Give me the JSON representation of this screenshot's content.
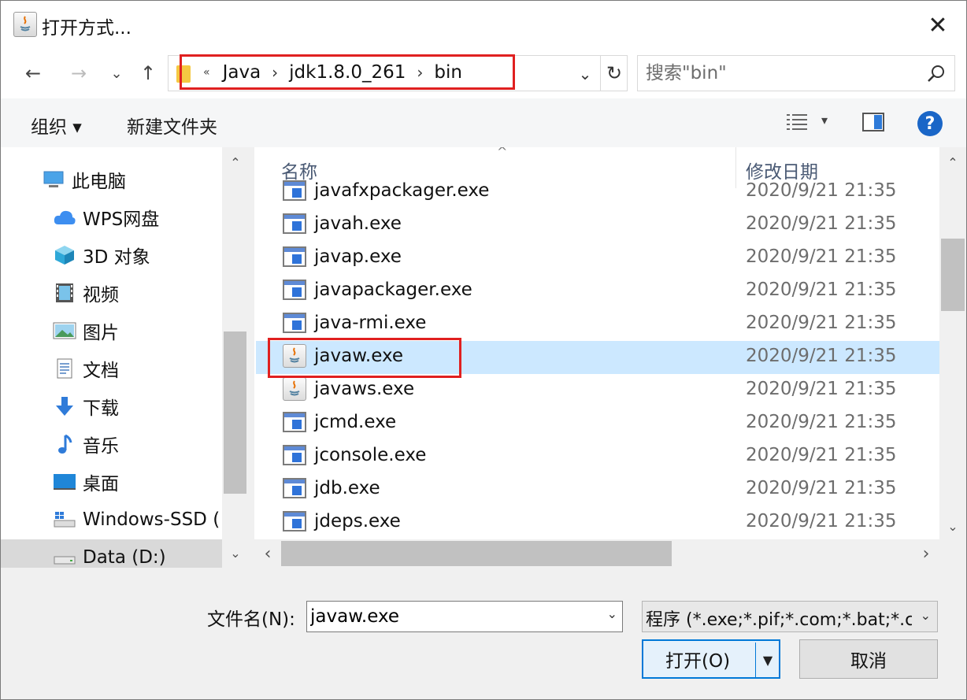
{
  "window": {
    "title": "打开方式...",
    "close_symbol": "✕"
  },
  "nav": {
    "back_symbol": "←",
    "forward_symbol": "→",
    "recent_symbol": "⌄",
    "up_symbol": "↑"
  },
  "address": {
    "overflow_symbol": "«",
    "crumbs": [
      "Java",
      "jdk1.8.0_261",
      "bin"
    ],
    "separator": "›",
    "dropdown_symbol": "⌄",
    "refresh_symbol": "↻"
  },
  "search": {
    "placeholder": "搜索\"bin\""
  },
  "toolbar": {
    "organize_label": "组织 ▾",
    "new_folder_label": "新建文件夹",
    "view_dropdown_symbol": "▾",
    "help_symbol": "?"
  },
  "sidebar": {
    "items": [
      {
        "label": "此电脑",
        "icon": "computer-icon"
      },
      {
        "label": "WPS网盘",
        "icon": "cloud-icon"
      },
      {
        "label": "3D 对象",
        "icon": "cube-3d-icon"
      },
      {
        "label": "视频",
        "icon": "video-icon"
      },
      {
        "label": "图片",
        "icon": "pictures-icon"
      },
      {
        "label": "文档",
        "icon": "documents-icon"
      },
      {
        "label": "下载",
        "icon": "download-icon"
      },
      {
        "label": "音乐",
        "icon": "music-icon"
      },
      {
        "label": "桌面",
        "icon": "desktop-icon"
      },
      {
        "label": "Windows-SSD (",
        "icon": "windows-drive-icon"
      },
      {
        "label": "Data (D:)",
        "icon": "drive-icon",
        "selected": true
      }
    ]
  },
  "filelist": {
    "columns": {
      "name": "名称",
      "modified": "修改日期"
    },
    "sort_indicator": "^",
    "rows": [
      {
        "name": "javafxpackager.exe",
        "date": "2020/9/21 21:35",
        "icon": "exe-icon"
      },
      {
        "name": "javah.exe",
        "date": "2020/9/21 21:35",
        "icon": "exe-icon"
      },
      {
        "name": "javap.exe",
        "date": "2020/9/21 21:35",
        "icon": "exe-icon"
      },
      {
        "name": "javapackager.exe",
        "date": "2020/9/21 21:35",
        "icon": "exe-icon"
      },
      {
        "name": "java-rmi.exe",
        "date": "2020/9/21 21:35",
        "icon": "exe-icon"
      },
      {
        "name": "javaw.exe",
        "date": "2020/9/21 21:35",
        "icon": "java-icon",
        "selected": true
      },
      {
        "name": "javaws.exe",
        "date": "2020/9/21 21:35",
        "icon": "java-icon"
      },
      {
        "name": "jcmd.exe",
        "date": "2020/9/21 21:35",
        "icon": "exe-icon"
      },
      {
        "name": "jconsole.exe",
        "date": "2020/9/21 21:35",
        "icon": "exe-icon"
      },
      {
        "name": "jdb.exe",
        "date": "2020/9/21 21:35",
        "icon": "exe-icon"
      },
      {
        "name": "jdeps.exe",
        "date": "2020/9/21 21:35",
        "icon": "exe-icon"
      }
    ]
  },
  "scroll": {
    "up": "⌃",
    "down": "⌄",
    "left": "‹",
    "right": "›"
  },
  "bottom": {
    "filename_label": "文件名(N):",
    "filename_value": "javaw.exe",
    "filename_dropdown": "⌄",
    "filter_value": "程序 (*.exe;*.pif;*.com;*.bat;*.c",
    "filter_dropdown": "⌄",
    "open_label": "打开(O)",
    "open_split_symbol": "▼",
    "cancel_label": "取消"
  },
  "colors": {
    "highlight_red": "#e02020",
    "selection_blue": "#cce8ff",
    "primary_border": "#0078d7",
    "help_blue": "#1a66c7"
  }
}
